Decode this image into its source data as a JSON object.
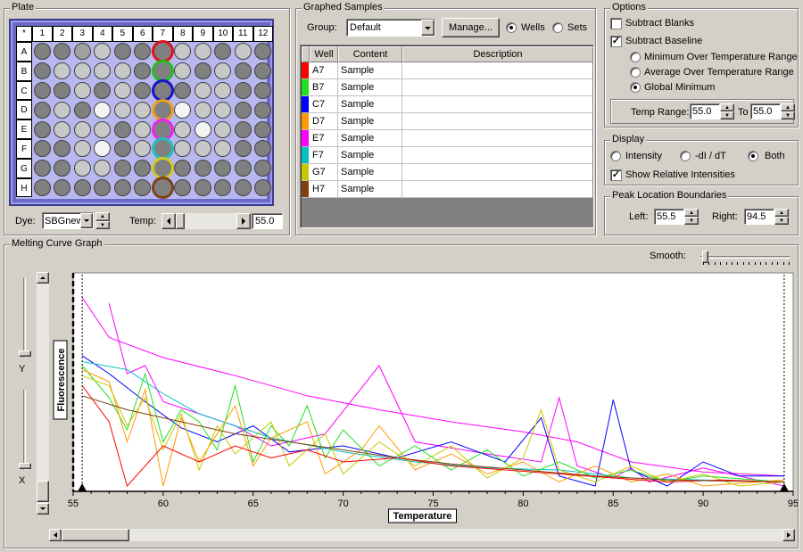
{
  "plate": {
    "title": "Plate",
    "corner": "*",
    "cols": [
      "1",
      "2",
      "3",
      "4",
      "5",
      "6",
      "7",
      "8",
      "9",
      "10",
      "11",
      "12"
    ],
    "rows": [
      "A",
      "B",
      "C",
      "D",
      "E",
      "F",
      "G",
      "H"
    ],
    "wells": [
      "DDMLDDRLLDLD",
      "DLLLLDRLDLDD",
      "DDLDLDRDLLDD",
      "DLDWLLRWLLDD",
      "DLLLDLRLWLDD",
      "DDLWDLRLLLDD",
      "DDLLDDRDDDDD",
      "DDDDDDRDDDDD"
    ],
    "selected_col_rings": [
      "#e0101c",
      "#20c020",
      "#1414c8",
      "#f0a020",
      "#f020f0",
      "#20c0c0",
      "#d0c820",
      "#804018"
    ],
    "dye_label": "Dye:",
    "dye_value": "SBGnew",
    "temp_label": "Temp:",
    "temp_value": "55.0"
  },
  "graphed": {
    "title": "Graphed Samples",
    "group_label": "Group:",
    "group_value": "Default",
    "manage_label": "Manage...",
    "wells_radio": "Wells",
    "sets_radio": "Sets",
    "columns": [
      "Well",
      "Content",
      "Description"
    ],
    "rows": [
      {
        "well": "A7",
        "content": "Sample",
        "description": "",
        "color": "#ff0000"
      },
      {
        "well": "B7",
        "content": "Sample",
        "description": "",
        "color": "#20e020"
      },
      {
        "well": "C7",
        "content": "Sample",
        "description": "",
        "color": "#0000ff"
      },
      {
        "well": "D7",
        "content": "Sample",
        "description": "",
        "color": "#ff9900"
      },
      {
        "well": "E7",
        "content": "Sample",
        "description": "",
        "color": "#ff00ff"
      },
      {
        "well": "F7",
        "content": "Sample",
        "description": "",
        "color": "#00c0c0"
      },
      {
        "well": "G7",
        "content": "Sample",
        "description": "",
        "color": "#c8c800"
      },
      {
        "well": "H7",
        "content": "Sample",
        "description": "",
        "color": "#804010"
      }
    ]
  },
  "options": {
    "title": "Options",
    "subtract_blanks": "Subtract Blanks",
    "subtract_blanks_checked": false,
    "subtract_baseline": "Subtract Baseline",
    "subtract_baseline_checked": true,
    "baseline_modes": [
      "Minimum Over Temperature Range",
      "Average Over Temperature Range",
      "Global Minimum"
    ],
    "baseline_selected": 2,
    "temp_range_label": "Temp Range:",
    "temp_from": "55.0",
    "to_label": "To",
    "temp_to": "55.0"
  },
  "display": {
    "title": "Display",
    "intensity": "Intensity",
    "derivative": "-dI / dT",
    "both": "Both",
    "selected": "both",
    "show_relative": "Show Relative Intensities",
    "show_relative_checked": true
  },
  "peak": {
    "title": "Peak Location Boundaries",
    "left_label": "Left:",
    "left_value": "55.5",
    "right_label": "Right:",
    "right_value": "94.5"
  },
  "graph": {
    "title": "Melting Curve Graph",
    "smooth_label": "Smooth:",
    "y_slider_label": "Y",
    "x_slider_label": "X"
  },
  "chart_data": {
    "type": "line",
    "xlabel": "Temperature",
    "ylabel": "Fluorescence",
    "xlim": [
      55,
      95
    ],
    "ylim": [
      0,
      1
    ],
    "xticks": [
      "55",
      "60",
      "65",
      "70",
      "75",
      "80",
      "85",
      "90",
      "95"
    ],
    "markers": [
      55.5,
      94.5
    ],
    "grid": false,
    "series": [
      {
        "color": "#ff00ff",
        "values": [
          [
            55.5,
            0.94
          ],
          [
            57,
            0.74
          ],
          [
            60,
            0.64
          ],
          [
            64,
            0.55
          ],
          [
            68,
            0.45
          ],
          [
            72,
            0.38
          ],
          [
            76,
            0.32
          ],
          [
            80,
            0.27
          ],
          [
            83,
            0.22
          ],
          [
            86,
            0.12
          ],
          [
            90,
            0.07
          ],
          [
            94.5,
            0.05
          ]
        ]
      },
      {
        "color": "#ff00ff",
        "values": [
          [
            57,
            0.91
          ],
          [
            58,
            0.56
          ],
          [
            59,
            0.6
          ],
          [
            60,
            0.42
          ],
          [
            62,
            0.36
          ],
          [
            64,
            0.3
          ],
          [
            66,
            0.2
          ],
          [
            69,
            0.26
          ],
          [
            72,
            0.6
          ],
          [
            74,
            0.22
          ],
          [
            78,
            0.16
          ],
          [
            81,
            0.12
          ],
          [
            82,
            0.44
          ],
          [
            83,
            0.1
          ],
          [
            85,
            0.04
          ],
          [
            86,
            0.09
          ],
          [
            87,
            0.02
          ],
          [
            90,
            0.09
          ],
          [
            92,
            0.05
          ],
          [
            94.5,
            0.0
          ]
        ]
      },
      {
        "color": "#0000ff",
        "values": [
          [
            55.5,
            0.65
          ],
          [
            57,
            0.56
          ],
          [
            59,
            0.42
          ],
          [
            61,
            0.29
          ],
          [
            63,
            0.22
          ],
          [
            65,
            0.3
          ],
          [
            67,
            0.17
          ],
          [
            70,
            0.2
          ],
          [
            73,
            0.14
          ],
          [
            76,
            0.22
          ],
          [
            79,
            0.12
          ],
          [
            81,
            0.34
          ],
          [
            82,
            0.05
          ],
          [
            84,
            0.0
          ],
          [
            85,
            0.43
          ],
          [
            86,
            0.08
          ],
          [
            88,
            0.0
          ],
          [
            90,
            0.12
          ],
          [
            92,
            0.05
          ],
          [
            94.5,
            0.05
          ]
        ]
      },
      {
        "color": "#00c0c0",
        "values": [
          [
            55.5,
            0.62
          ],
          [
            58,
            0.58
          ],
          [
            60,
            0.46
          ],
          [
            62,
            0.36
          ],
          [
            64,
            0.3
          ],
          [
            66,
            0.24
          ],
          [
            70,
            0.17
          ],
          [
            74,
            0.12
          ],
          [
            78,
            0.09
          ],
          [
            82,
            0.08
          ],
          [
            86,
            0.04
          ],
          [
            90,
            0.03
          ],
          [
            94.5,
            0.02
          ]
        ]
      },
      {
        "color": "#20e020",
        "values": [
          [
            55.5,
            0.6
          ],
          [
            57,
            0.44
          ],
          [
            58,
            0.28
          ],
          [
            59,
            0.56
          ],
          [
            60,
            0.22
          ],
          [
            61,
            0.38
          ],
          [
            62,
            0.32
          ],
          [
            63,
            0.18
          ],
          [
            64,
            0.5
          ],
          [
            65,
            0.12
          ],
          [
            66,
            0.3
          ],
          [
            67,
            0.2
          ],
          [
            68,
            0.4
          ],
          [
            69,
            0.14
          ],
          [
            70,
            0.28
          ],
          [
            72,
            0.1
          ],
          [
            74,
            0.2
          ],
          [
            76,
            0.08
          ],
          [
            78,
            0.18
          ],
          [
            80,
            0.05
          ],
          [
            82,
            0.12
          ],
          [
            84,
            0.04
          ],
          [
            86,
            0.08
          ],
          [
            88,
            0.02
          ],
          [
            90,
            0.05
          ],
          [
            94.5,
            0.02
          ]
        ]
      },
      {
        "color": "#ff9900",
        "values": [
          [
            55.5,
            0.58
          ],
          [
            57,
            0.52
          ],
          [
            58,
            0.22
          ],
          [
            59,
            0.48
          ],
          [
            60,
            0.0
          ],
          [
            61,
            0.34
          ],
          [
            62,
            0.12
          ],
          [
            64,
            0.4
          ],
          [
            65,
            0.1
          ],
          [
            66,
            0.24
          ],
          [
            68,
            0.32
          ],
          [
            69,
            0.06
          ],
          [
            71,
            0.18
          ],
          [
            72,
            0.3
          ],
          [
            74,
            0.08
          ],
          [
            76,
            0.16
          ],
          [
            78,
            0.06
          ],
          [
            80,
            0.12
          ],
          [
            82,
            0.02
          ],
          [
            84,
            0.1
          ],
          [
            86,
            0.02
          ],
          [
            88,
            0.06
          ],
          [
            90,
            0.0
          ],
          [
            94.5,
            0.03
          ]
        ]
      },
      {
        "color": "#c8c800",
        "values": [
          [
            55.5,
            0.55
          ],
          [
            57,
            0.5
          ],
          [
            58,
            0.3
          ],
          [
            59,
            0.44
          ],
          [
            60,
            0.18
          ],
          [
            61,
            0.36
          ],
          [
            62,
            0.08
          ],
          [
            63,
            0.3
          ],
          [
            64,
            0.16
          ],
          [
            66,
            0.32
          ],
          [
            67,
            0.1
          ],
          [
            69,
            0.26
          ],
          [
            70,
            0.06
          ],
          [
            72,
            0.22
          ],
          [
            74,
            0.1
          ],
          [
            76,
            0.2
          ],
          [
            78,
            0.04
          ],
          [
            80,
            0.14
          ],
          [
            81,
            0.38
          ],
          [
            82,
            0.08
          ],
          [
            84,
            0.02
          ],
          [
            86,
            0.1
          ],
          [
            88,
            0.02
          ],
          [
            90,
            0.06
          ],
          [
            92,
            0.0
          ],
          [
            94.5,
            0.02
          ]
        ]
      },
      {
        "color": "#ff0000",
        "values": [
          [
            55.5,
            0.5
          ],
          [
            57,
            0.32
          ],
          [
            58,
            0.0
          ],
          [
            60,
            0.2
          ],
          [
            62,
            0.12
          ],
          [
            64,
            0.2
          ],
          [
            66,
            0.14
          ],
          [
            68,
            0.18
          ],
          [
            70,
            0.12
          ],
          [
            73,
            0.14
          ],
          [
            76,
            0.1
          ],
          [
            79,
            0.08
          ],
          [
            82,
            0.06
          ],
          [
            85,
            0.04
          ],
          [
            88,
            0.02
          ],
          [
            91,
            0.03
          ],
          [
            94.5,
            0.02
          ]
        ]
      },
      {
        "color": "#804010",
        "values": [
          [
            55.5,
            0.45
          ],
          [
            58,
            0.38
          ],
          [
            61,
            0.32
          ],
          [
            64,
            0.26
          ],
          [
            67,
            0.22
          ],
          [
            70,
            0.18
          ],
          [
            73,
            0.14
          ],
          [
            76,
            0.11
          ],
          [
            80,
            0.08
          ],
          [
            84,
            0.05
          ],
          [
            88,
            0.03
          ],
          [
            94.5,
            0.02
          ]
        ]
      }
    ]
  }
}
